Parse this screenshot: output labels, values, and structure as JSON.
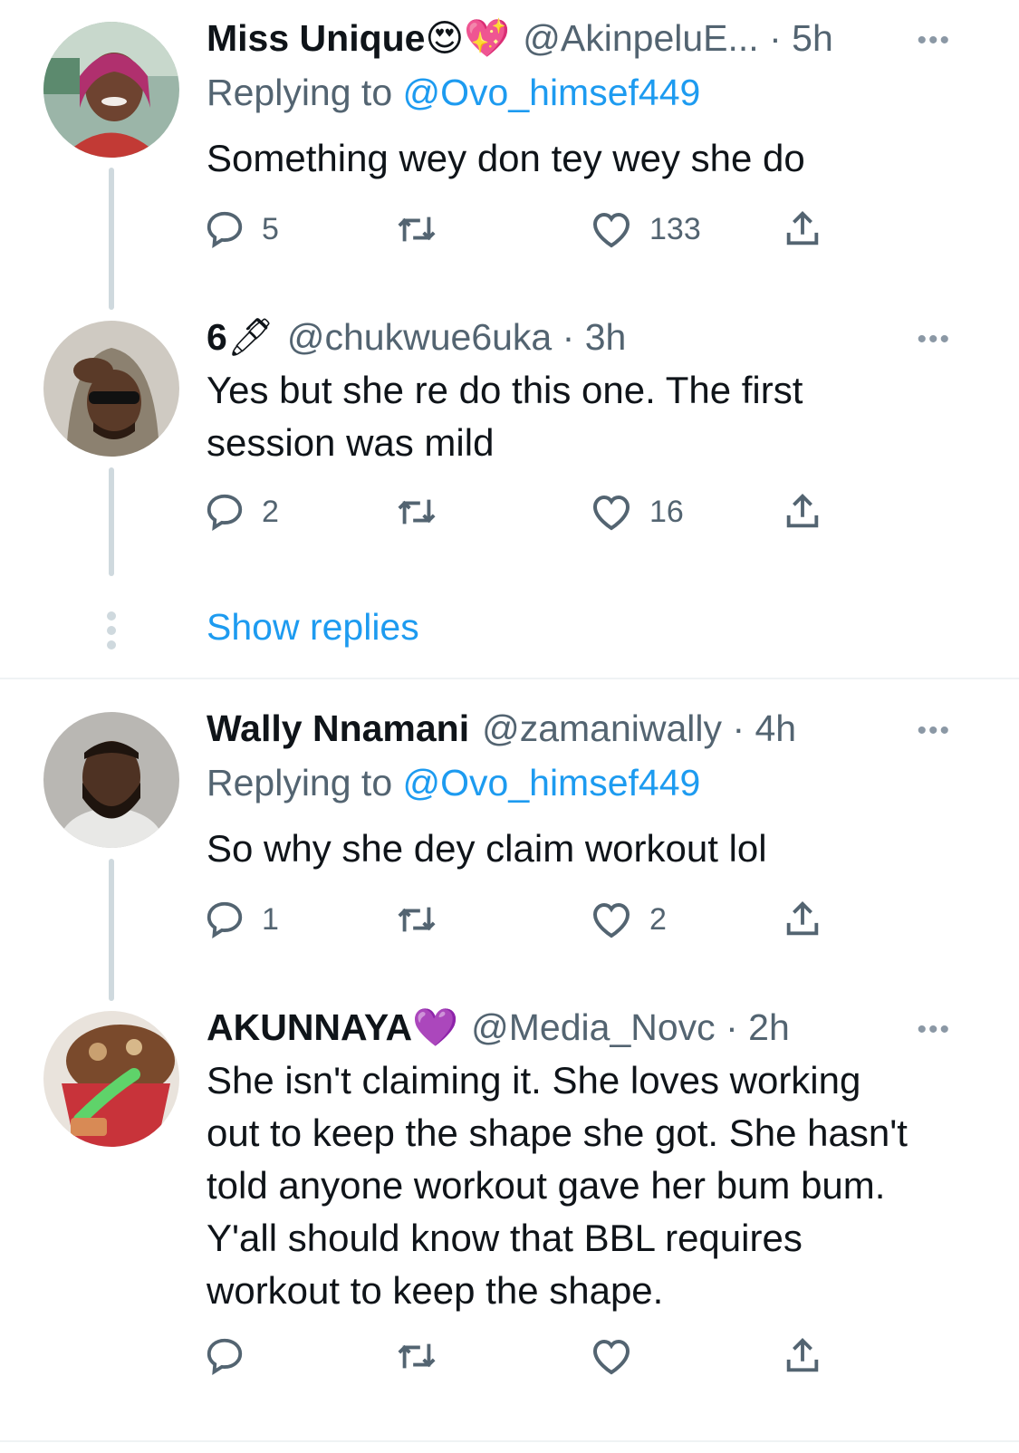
{
  "tweets": [
    {
      "name": "Miss Unique",
      "emoji": "😍💖",
      "handle": "@AkinpeluE...",
      "time": "5h",
      "replying_label": "Replying to",
      "replying_to": "@Ovo_himsef449",
      "text": "Something wey don tey wey she do",
      "replies": "5",
      "retweets": "",
      "likes": "133"
    },
    {
      "name": "6",
      "emoji": "🖊",
      "handle": "@chukwue6uka",
      "time": "3h",
      "text": "Yes but she re do this one.  The first session was mild",
      "replies": "2",
      "retweets": "",
      "likes": "16"
    },
    {
      "name": "Wally Nnamani",
      "emoji": "",
      "handle": "@zamaniwally",
      "time": "4h",
      "replying_label": "Replying to",
      "replying_to": "@Ovo_himsef449",
      "text": "So why she dey claim workout lol",
      "replies": "1",
      "retweets": "",
      "likes": "2"
    },
    {
      "name": "AKUNNAYA",
      "emoji": "💜",
      "handle": "@Media_Novc",
      "time": "2h",
      "text": "She isn't claiming it. She loves working out to keep the shape she got. She hasn't told anyone workout gave her bum bum. Y'all should know that BBL requires workout to keep the shape.",
      "replies": "",
      "retweets": "",
      "likes": ""
    }
  ],
  "show_replies_label": "Show replies",
  "separator": "·",
  "more_label": "•••",
  "icons": [
    "reply-icon",
    "retweet-icon",
    "like-icon",
    "share-icon",
    "more-icon"
  ],
  "colors": {
    "link": "#1d9bf0",
    "secondary": "#536471",
    "line": "#cfd9de"
  }
}
